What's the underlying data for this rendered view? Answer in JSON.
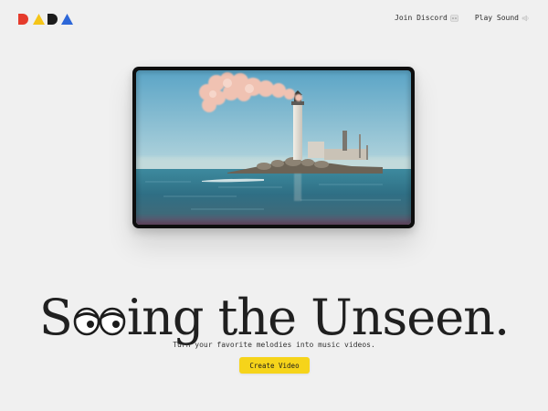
{
  "brand": {
    "logo_text": "DADA",
    "colors": [
      "#e53b2c",
      "#f5c518",
      "#1c1c1c",
      "#2d67d8"
    ]
  },
  "nav": {
    "discord_label": "Join Discord",
    "discord_icon": "discord-icon",
    "sound_label": "Play Sound",
    "sound_icon": "speaker-icon"
  },
  "hero": {
    "headline_before": "S",
    "headline_eyes_icon": "eyes-icon",
    "headline_after": "ing the Unseen.",
    "subtitle": "Turn your favorite melodies into music videos.",
    "cta_label": "Create Video",
    "cta_color": "#f6d41a"
  },
  "video": {
    "scene": "lighthouse-with-smoke-by-sea"
  }
}
